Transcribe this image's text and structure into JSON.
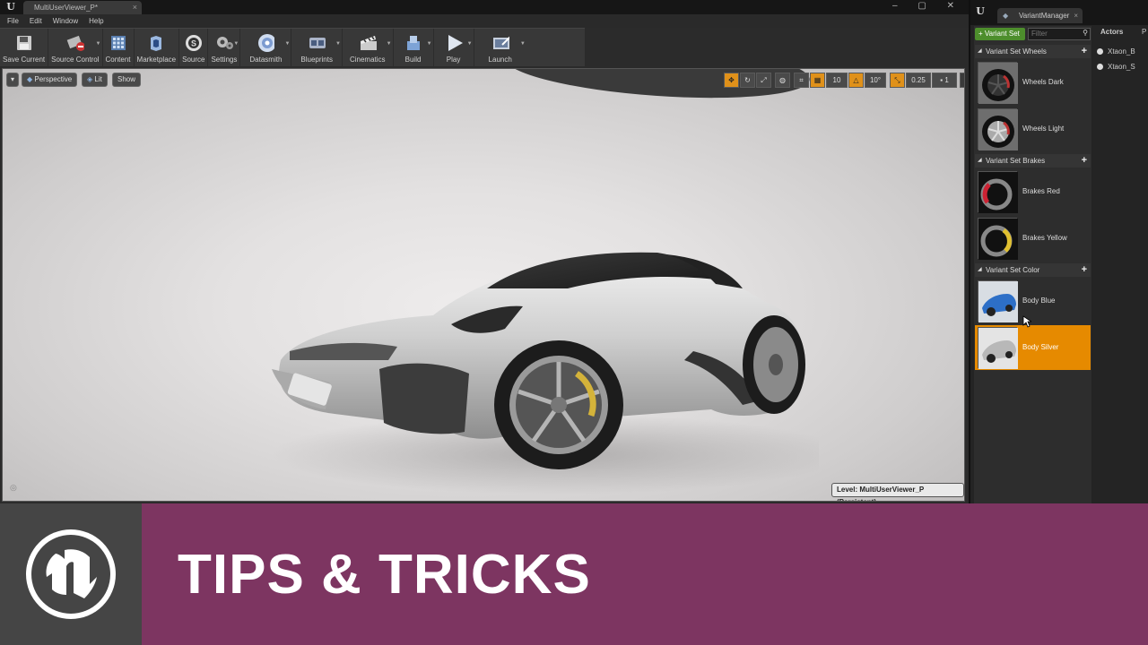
{
  "window": {
    "doc_tab": "MultiUserViewer_P*",
    "controls": "– ▢ ✕"
  },
  "menu": [
    "File",
    "Edit",
    "Window",
    "Help"
  ],
  "toolbar": [
    {
      "label": "Save Current",
      "icon": "save-icon"
    },
    {
      "label": "Source Control",
      "icon": "source-control-icon"
    },
    {
      "label": "Content",
      "icon": "content-icon"
    },
    {
      "label": "Marketplace",
      "icon": "marketplace-icon"
    },
    {
      "label": "Source",
      "icon": "source-icon"
    },
    {
      "label": "Settings",
      "icon": "settings-icon"
    },
    {
      "label": "Datasmith",
      "icon": "datasmith-icon"
    },
    {
      "label": "Blueprints",
      "icon": "blueprints-icon"
    },
    {
      "label": "Cinematics",
      "icon": "cinematics-icon"
    },
    {
      "label": "Build",
      "icon": "build-icon"
    },
    {
      "label": "Play",
      "icon": "play-icon"
    },
    {
      "label": "Launch",
      "icon": "launch-icon"
    }
  ],
  "viewport": {
    "perspective": "Perspective",
    "lit": "Lit",
    "show": "Show",
    "grid_snap": "10",
    "rot_snap": "10°",
    "scale_snap": "0.25",
    "cam_speed": "1",
    "level": "Level:  MultiUserViewer_P (Persistent)"
  },
  "variant_manager": {
    "tab": "VariantManager",
    "add_button": "+ Variant Set",
    "filter_placeholder": "Filter",
    "actors_header": "Actors",
    "actors_extra": "P",
    "sets": [
      {
        "name": "Variant Set Wheels",
        "variants": [
          {
            "name": "Wheels Dark",
            "selected": false
          },
          {
            "name": "Wheels Light",
            "selected": false
          }
        ]
      },
      {
        "name": "Variant Set Brakes",
        "variants": [
          {
            "name": "Brakes Red",
            "selected": false
          },
          {
            "name": "Brakes Yellow",
            "selected": false
          }
        ]
      },
      {
        "name": "Variant Set Color",
        "variants": [
          {
            "name": "Body Blue",
            "selected": false
          },
          {
            "name": "Body Silver",
            "selected": true
          }
        ]
      }
    ],
    "actors": [
      "Xtaon_B",
      "Xtaon_S"
    ]
  },
  "banner": {
    "title": "TIPS & TRICKS",
    "bg_color": "#7d3561"
  },
  "colors": {
    "accent_orange": "#e68a00",
    "add_green": "#4d8e2c"
  }
}
